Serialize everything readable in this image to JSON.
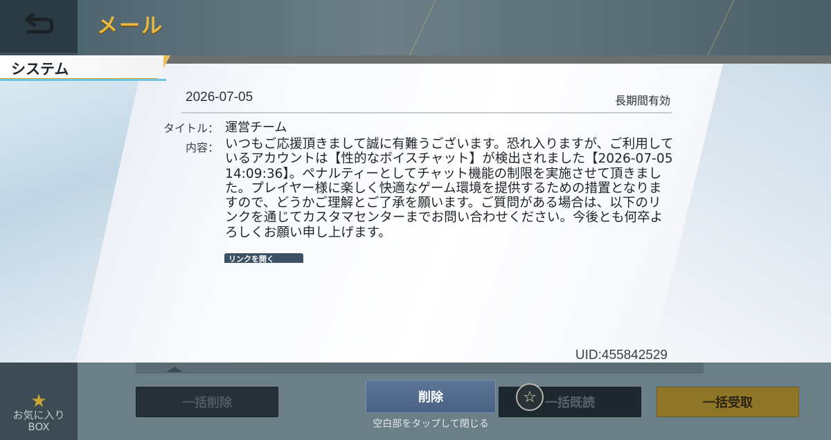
{
  "header": {
    "back_icon": "back-arrow-icon",
    "title": "メール"
  },
  "tab": {
    "label": "システム"
  },
  "mail": {
    "date": "2026-07-05",
    "validity": "長期間有効",
    "title_label": "タイトル：",
    "title": "運営チーム",
    "content_label": "内容：",
    "body": "いつもご応援頂きまして誠に有難うございます。恐れ入りますが、ご利用しているアカウントは【性的なボイスチャット】が検出されました【2026-07-05 14:09:36】。ペナルティーとしてチャット機能の制限を実施させて頂きました。プレイヤー様に楽しく快適なゲーム環境を提供するための措置となりますので、どうかご理解とご了承を願います。ご質問がある場合は、以下のリンクを通じてカスタマセンターまでお問い合わせください。今後とも何卒よろしくお願い申し上げます。",
    "link_button": "リンクを開く",
    "uid": "UID:455842529"
  },
  "footer": {
    "favorite_box": [
      "お気に入り",
      "BOX"
    ],
    "bulk_delete": "一括削除",
    "delete": "削除",
    "bulk_read": "一括既読",
    "bulk_receive": "一括受取",
    "close_hint": "空白部をタップして閉じる",
    "star_icon": "star-icon"
  },
  "colors": {
    "header_title": "#e7b941",
    "delete_button": "#4a6184",
    "bulk_receive_button": "#8f7526",
    "tab_underline": "#6fc5e0"
  }
}
